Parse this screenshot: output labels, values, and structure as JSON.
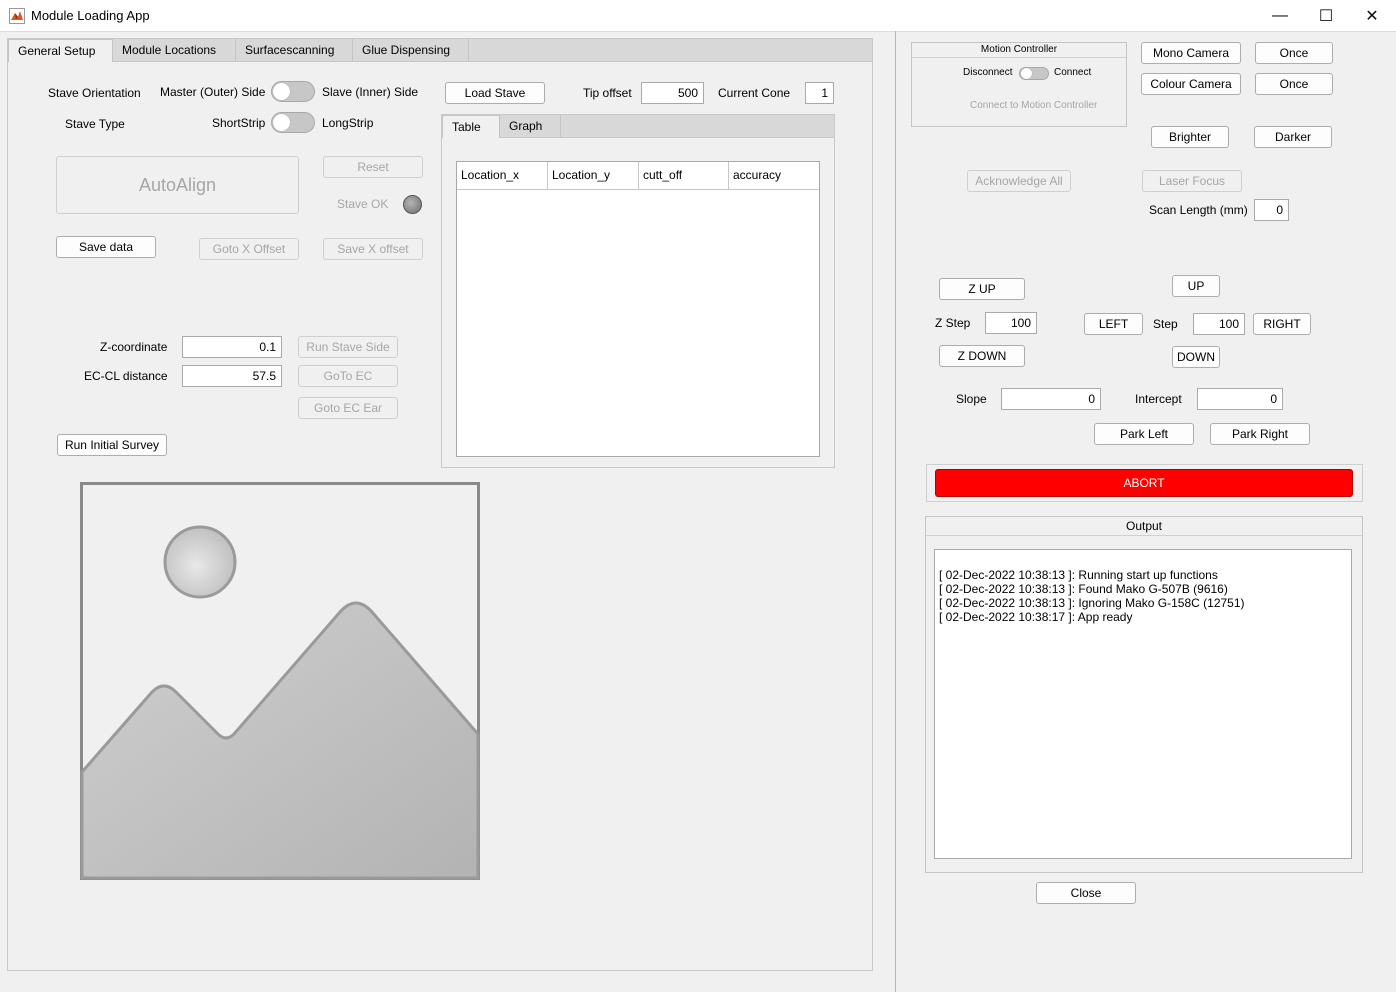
{
  "window": {
    "title": "Module Loading App",
    "minimize": "—",
    "maximize": "☐",
    "close": "✕"
  },
  "tabs": [
    "General Setup",
    "Module Locations",
    "Surfacescanning",
    "Glue Dispensing"
  ],
  "general": {
    "stave_orientation_label": "Stave Orientation",
    "master_side_label": "Master (Outer) Side",
    "slave_side_label": "Slave (Inner) Side",
    "stave_type_label": "Stave Type",
    "shortstrip_label": "ShortStrip",
    "longstrip_label": "LongStrip",
    "load_stave_label": "Load Stave",
    "tip_offset_label": "Tip offset",
    "tip_offset_value": "500",
    "current_cone_label": "Current Cone",
    "current_cone_value": "1",
    "autoalign_label": "AutoAlign",
    "reset_label": "Reset",
    "stave_ok_label": "Stave OK",
    "save_data_label": "Save data",
    "goto_x_offset_label": "Goto X Offset",
    "save_x_offset_label": "Save X offset",
    "z_coordinate_label": "Z-coordinate",
    "z_coordinate_value": "0.1",
    "ec_cl_label": "EC-CL distance",
    "ec_cl_value": "57.5",
    "run_stave_side_label": "Run Stave Side",
    "goto_ec_label": "GoTo EC",
    "goto_ec_ear_label": "Goto EC Ear",
    "run_initial_survey_label": "Run Initial Survey"
  },
  "inner_tabs": [
    "Table",
    "Graph"
  ],
  "table": {
    "columns": [
      "Location_x",
      "Location_y",
      "cutt_off",
      "accuracy"
    ]
  },
  "motion": {
    "title": "Motion Controller",
    "disconnect_label": "Disconnect",
    "connect_label": "Connect",
    "status": "Connect to Motion Controller"
  },
  "camera": {
    "mono_label": "Mono Camera",
    "colour_label": "Colour Camera",
    "once_label": "Once",
    "brighter_label": "Brighter",
    "darker_label": "Darker",
    "acknowledge_label": "Acknowledge All",
    "laser_focus_label": "Laser Focus",
    "scan_length_label": "Scan Length (mm)",
    "scan_length_value": "0"
  },
  "motion_ctrl": {
    "z_up": "Z UP",
    "z_step_label": "Z Step",
    "z_step_value": "100",
    "z_down": "Z DOWN",
    "up": "UP",
    "left": "LEFT",
    "step_label": "Step",
    "step_value": "100",
    "right": "RIGHT",
    "down": "DOWN",
    "slope_label": "Slope",
    "slope_value": "0",
    "intercept_label": "Intercept",
    "intercept_value": "0",
    "park_left": "Park Left",
    "park_right": "Park Right",
    "abort": "ABORT"
  },
  "output": {
    "title": "Output",
    "lines": [
      "[ 02-Dec-2022 10:38:13 ]: Running start up functions",
      "[ 02-Dec-2022 10:38:13 ]: Found Mako G-507B (9616)",
      "[ 02-Dec-2022 10:38:13 ]: Ignoring Mako G-158C (12751)",
      "[ 02-Dec-2022 10:38:17 ]: App ready"
    ]
  },
  "close_label": "Close",
  "colors": {
    "abort": "#ff0000",
    "background": "#f0f0f0"
  }
}
